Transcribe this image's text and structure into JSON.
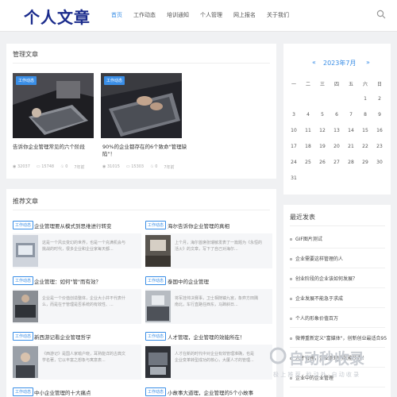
{
  "site": {
    "logo": "个人文章"
  },
  "nav": [
    "首页",
    "工作动态",
    "培训通知",
    "个人管理",
    "网上报名",
    "关于我们"
  ],
  "management": {
    "title": "管理文章",
    "cards": [
      {
        "tag": "工作动态",
        "title": "告诉你企业管理常见的六个阶段",
        "views": "32037",
        "comments": "15748",
        "likes": "0",
        "time": "7年前"
      },
      {
        "tag": "工作动态",
        "title": "90%的企业都存在的6个致命\"管理缺陷\"！",
        "views": "31015",
        "comments": "15303",
        "likes": "0",
        "time": "7年前"
      }
    ]
  },
  "recommended": {
    "title": "推荐文章",
    "items": [
      {
        "tag": "工作动态",
        "title": "企业管理要从模式到思维进行转变",
        "text1": "这是一个风云变幻的世界，也是一个充满机会与",
        "text2": "挑战的时代，很多企业和企业家每天都..."
      },
      {
        "tag": "工作动态",
        "title": "海尔告诉你企业管理的真相",
        "text1": "上个月，海尔首席张瑞敏发表了一篇题为《永恒的",
        "text2": "活火》的文章，写下了自己对海尔..."
      },
      {
        "tag": "工作动态",
        "title": "企业管理：如何\"管\"而有效？",
        "text1": "企业是一个价值创造整体，企业大小并不代表什",
        "text2": "么，而是在于管理是否系统的有效性、..."
      },
      {
        "tag": "工作动态",
        "title": "泰国中的企业管理",
        "text1": "将军挂帅决赛事，卫士相随镇九宫，象弈方田隅",
        "text2": "南北，车行直路任西东，马蹄斜日..."
      },
      {
        "tag": "工作动态",
        "title": "新西游记看企业管理哲学",
        "text1": "《西游记》是国人家喻户晓，耳熟能详的古典文",
        "text2": "学名著，它以丰富之想象与寓意表..."
      },
      {
        "tag": "工作动态",
        "title": "人才管理，企业管理的效能所在！",
        "text1": "人才在新的时代中对企业有效管理准确，也是",
        "text2": "企业变革转型成功的核心，大厦人才的管理..."
      },
      {
        "tag": "工作动态",
        "title": "中小企业管理的十大痛点",
        "text1": "",
        "text2": ""
      },
      {
        "tag": "工作动态",
        "title": "小故事大道理，企业管理的5个小故事",
        "text1": "",
        "text2": ""
      }
    ]
  },
  "calendar": {
    "prev": "«",
    "month": "2023年7月",
    "next": "»",
    "weekdays": [
      "一",
      "二",
      "三",
      "四",
      "五",
      "六",
      "日"
    ],
    "days": [
      "",
      "",
      "",
      "",
      "",
      "1",
      "2",
      "3",
      "4",
      "5",
      "6",
      "7",
      "8",
      "9",
      "10",
      "11",
      "12",
      "13",
      "14",
      "15",
      "16",
      "17",
      "18",
      "19",
      "20",
      "21",
      "22",
      "23",
      "24",
      "25",
      "26",
      "27",
      "28",
      "29",
      "30",
      "31",
      "",
      "",
      "",
      "",
      "",
      ""
    ]
  },
  "latest": {
    "title": "最近发表",
    "items": [
      "GIF图片测试",
      "企业需要这样管理的人",
      "创业阶段的企业该如何发展？",
      "企业发展不能急于求成",
      "个人的形象价值百万",
      "微博重新定义\"富媒体\"，创新创业最适合95后？",
      "人才管理，企业管理的效能所在！",
      "企业中的企业管理"
    ]
  },
  "watermark": {
    "main": "自动秒收录",
    "sub": "极 上 推 荐 · 秒 动 外 · 自 动 收 录"
  }
}
